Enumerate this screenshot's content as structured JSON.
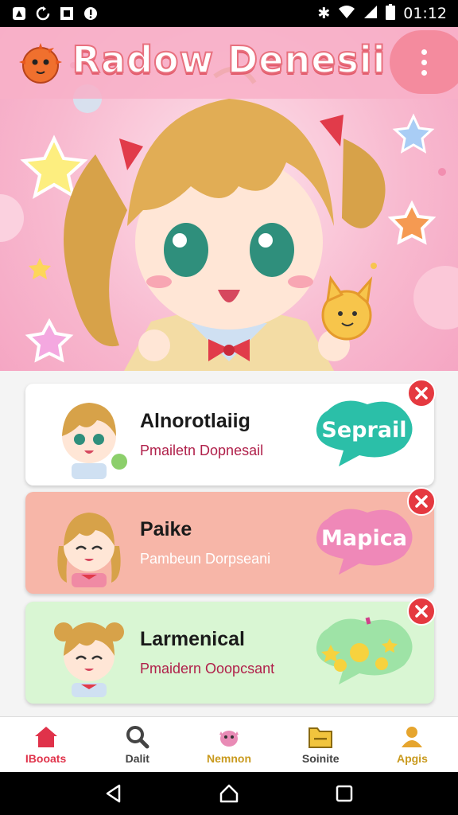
{
  "status_bar": {
    "time": "01:12",
    "icons": [
      "app-icon",
      "sync-icon",
      "square-icon",
      "info-icon",
      "bluetooth-icon",
      "wifi-icon",
      "signal-icon",
      "battery-icon"
    ]
  },
  "header": {
    "title": "Radow Denesii",
    "menu_icon": "more-vert-icon"
  },
  "cards": [
    {
      "title": "Alnorotlaiig",
      "subtitle": "Pmailetn Dopnesail",
      "bubble": "Seprail",
      "bubble_color": "#2bbfa8",
      "bg": "#ffffff"
    },
    {
      "title": "Paike",
      "subtitle": "Pambeun Dorpseani",
      "bubble": "Mapica",
      "bubble_color": "#ef88b8",
      "bg": "#f7b6a8"
    },
    {
      "title": "Larmenical",
      "subtitle": "Pmaidern Ooopcsant",
      "bubble": "",
      "bubble_color": "#9ee3a6",
      "bg": "#d9f6d3"
    }
  ],
  "bottom_nav": [
    {
      "label": "IBooats",
      "icon": "home-icon",
      "color": "#e0324a",
      "active": true
    },
    {
      "label": "Dalit",
      "icon": "search-icon",
      "color": "#444444",
      "active": false
    },
    {
      "label": "Nemnon",
      "icon": "monster-icon",
      "color": "#c99a1e",
      "active": false
    },
    {
      "label": "Soinite",
      "icon": "folder-icon",
      "color": "#444444",
      "active": false
    },
    {
      "label": "Apgis",
      "icon": "profile-icon",
      "color": "#c99a1e",
      "active": false
    }
  ],
  "colors": {
    "accent": "#e35d6d",
    "close": "#e53940"
  }
}
